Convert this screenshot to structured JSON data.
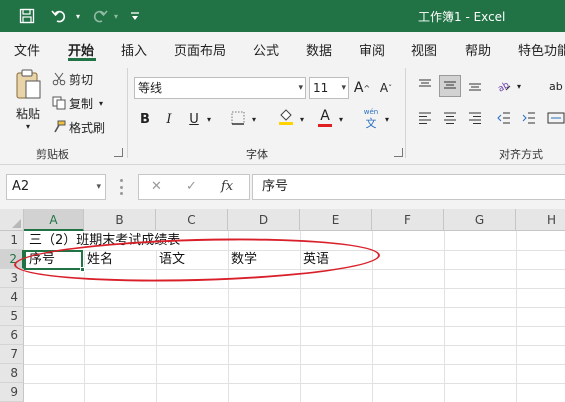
{
  "window": {
    "title": "工作簿1 - Excel"
  },
  "qat": {
    "save_icon": "save-icon",
    "undo_icon": "undo-icon",
    "redo_icon": "redo-icon",
    "customize_icon": "customize-qat-icon"
  },
  "tabs": [
    "文件",
    "开始",
    "插入",
    "页面布局",
    "公式",
    "数据",
    "审阅",
    "视图",
    "帮助",
    "特色功能"
  ],
  "active_tab": "开始",
  "ribbon": {
    "clipboard": {
      "label": "剪贴板",
      "paste": "粘贴",
      "cut": "剪切",
      "copy": "复制",
      "format_painter": "格式刷"
    },
    "font": {
      "label": "字体",
      "font_name": "等线",
      "font_size": "11",
      "grow": "A",
      "shrink": "A",
      "bold": "B",
      "italic": "I",
      "underline": "U",
      "font_color_letter": "A",
      "phonetic_top": "wén",
      "phonetic_bottom": "文",
      "highlight_color": "#ffd400",
      "font_color": "#e02020"
    },
    "alignment": {
      "label": "对齐方式",
      "partial_right": "ab"
    }
  },
  "formula_bar": {
    "name_box": "A2",
    "cancel": "✕",
    "enter": "✓",
    "fx": "fx",
    "value": "序号"
  },
  "sheet": {
    "columns": [
      "A",
      "B",
      "C",
      "D",
      "E",
      "F",
      "G",
      "H"
    ],
    "rows": [
      "1",
      "2",
      "3",
      "4",
      "5",
      "6",
      "7",
      "8",
      "9"
    ],
    "selected_column": "A",
    "selected_row": "2",
    "cells": {
      "A1": "三（2）班期末考试成绩表",
      "A2": "序号",
      "B2": "姓名",
      "C2": "语文",
      "D2": "数学",
      "E2": "英语"
    }
  },
  "colors": {
    "accent": "#217346",
    "annotation": "#d9202a"
  }
}
